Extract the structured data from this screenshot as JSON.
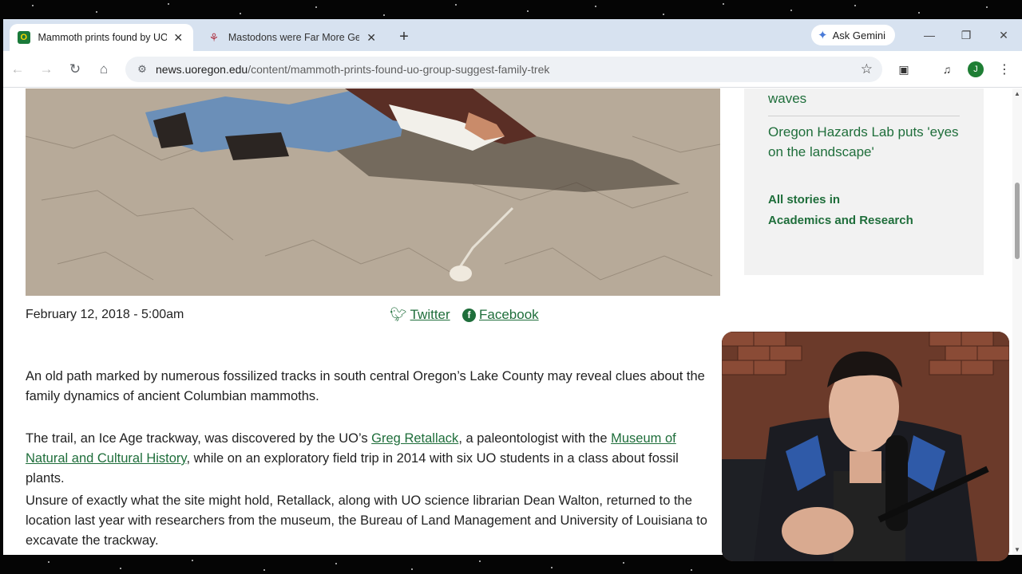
{
  "tabs": [
    {
      "title": "Mammoth prints found by UO group suggest family trek",
      "favicon": "uo-logo-icon",
      "active": true
    },
    {
      "title": "Mastodons were Far More Genetically Diverse",
      "favicon": "mastodon-site-icon",
      "active": false
    }
  ],
  "browser": {
    "ask_gemini": "Ask Gemini",
    "url_domain": "news.uoregon.edu",
    "url_path": "/content/mammoth-prints-found-uo-group-suggest-family-trek",
    "avatar_initial": "J",
    "accent_color": "#1f6e3b"
  },
  "article": {
    "date": "February 12, 2018 - 5:00am",
    "share_twitter": "Twitter",
    "share_facebook": "Facebook",
    "p1": "An old path marked by numerous fossilized tracks in south central Oregon’s Lake County may reveal clues about the family dynamics of ancient Columbian mammoths.",
    "p2_before": "The trail, an Ice Age trackway, was discovered by the UO’s ",
    "p2_link1": "Greg Retallack",
    "p2_middle": ", a paleontologist with the ",
    "p2_link2": "Museum of Natural and Cultural History",
    "p2_after": ", while on an exploratory field trip in 2014 with six UO students in a class about fossil plants.",
    "p3": "Unsure of exactly what the site might hold, Retallack, along with UO science librarian Dean Walton, returned to the location last year with researchers from the museum, the Bureau of Land Management and University of Louisiana to excavate the trackway."
  },
  "sidebar": {
    "link_partial": "waves",
    "link_hazards": "Oregon Hazards Lab puts 'eyes on the landscape'",
    "all_stories_line1": "All stories in",
    "all_stories_line2": "Academics and Research"
  }
}
